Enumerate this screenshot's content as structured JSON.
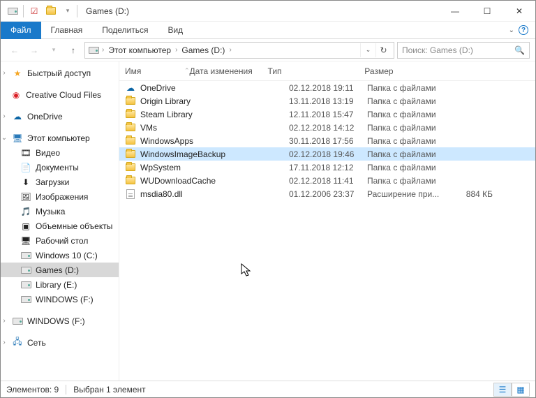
{
  "window": {
    "title": "Games (D:)"
  },
  "ribbon": {
    "file": "Файл",
    "tabs": [
      "Главная",
      "Поделиться",
      "Вид"
    ]
  },
  "address": {
    "crumbs": [
      "Этот компьютер",
      "Games (D:)"
    ],
    "search_placeholder": "Поиск: Games (D:)"
  },
  "columns": {
    "name": "Имя",
    "date": "Дата изменения",
    "type": "Тип",
    "size": "Размер"
  },
  "nav": {
    "quick": "Быстрый доступ",
    "ccf": "Creative Cloud Files",
    "onedrive": "OneDrive",
    "thispc": "Этот компьютер",
    "items": [
      {
        "label": "Видео",
        "glyph": "🎞"
      },
      {
        "label": "Документы",
        "glyph": "📄"
      },
      {
        "label": "Загрузки",
        "glyph": "⬇"
      },
      {
        "label": "Изображения",
        "glyph": "🖼"
      },
      {
        "label": "Музыка",
        "glyph": "🎵"
      },
      {
        "label": "Объемные объекты",
        "glyph": "▣"
      },
      {
        "label": "Рабочий стол",
        "glyph": "🖥"
      }
    ],
    "drives": [
      {
        "label": "Windows 10 (C:)"
      },
      {
        "label": "Games (D:)",
        "selected": true
      },
      {
        "label": "Library (E:)"
      },
      {
        "label": "WINDOWS (F:)"
      }
    ],
    "extra_drive": "WINDOWS (F:)",
    "network": "Сеть"
  },
  "files": [
    {
      "name": "OneDrive",
      "date": "02.12.2018 19:11",
      "type": "Папка с файлами",
      "size": "",
      "icon": "cloud"
    },
    {
      "name": "Origin Library",
      "date": "13.11.2018 13:19",
      "type": "Папка с файлами",
      "size": "",
      "icon": "folder"
    },
    {
      "name": "Steam Library",
      "date": "12.11.2018 15:47",
      "type": "Папка с файлами",
      "size": "",
      "icon": "folder"
    },
    {
      "name": "VMs",
      "date": "02.12.2018 14:12",
      "type": "Папка с файлами",
      "size": "",
      "icon": "folder"
    },
    {
      "name": "WindowsApps",
      "date": "30.11.2018 17:56",
      "type": "Папка с файлами",
      "size": "",
      "icon": "folder"
    },
    {
      "name": "WindowsImageBackup",
      "date": "02.12.2018 19:46",
      "type": "Папка с файлами",
      "size": "",
      "icon": "folder",
      "selected": true
    },
    {
      "name": "WpSystem",
      "date": "17.11.2018 12:12",
      "type": "Папка с файлами",
      "size": "",
      "icon": "folder"
    },
    {
      "name": "WUDownloadCache",
      "date": "02.12.2018 11:41",
      "type": "Папка с файлами",
      "size": "",
      "icon": "folder"
    },
    {
      "name": "msdia80.dll",
      "date": "01.12.2006 23:37",
      "type": "Расширение при...",
      "size": "884 КБ",
      "icon": "dll"
    }
  ],
  "status": {
    "count": "Элементов: 9",
    "selected": "Выбран 1 элемент"
  }
}
